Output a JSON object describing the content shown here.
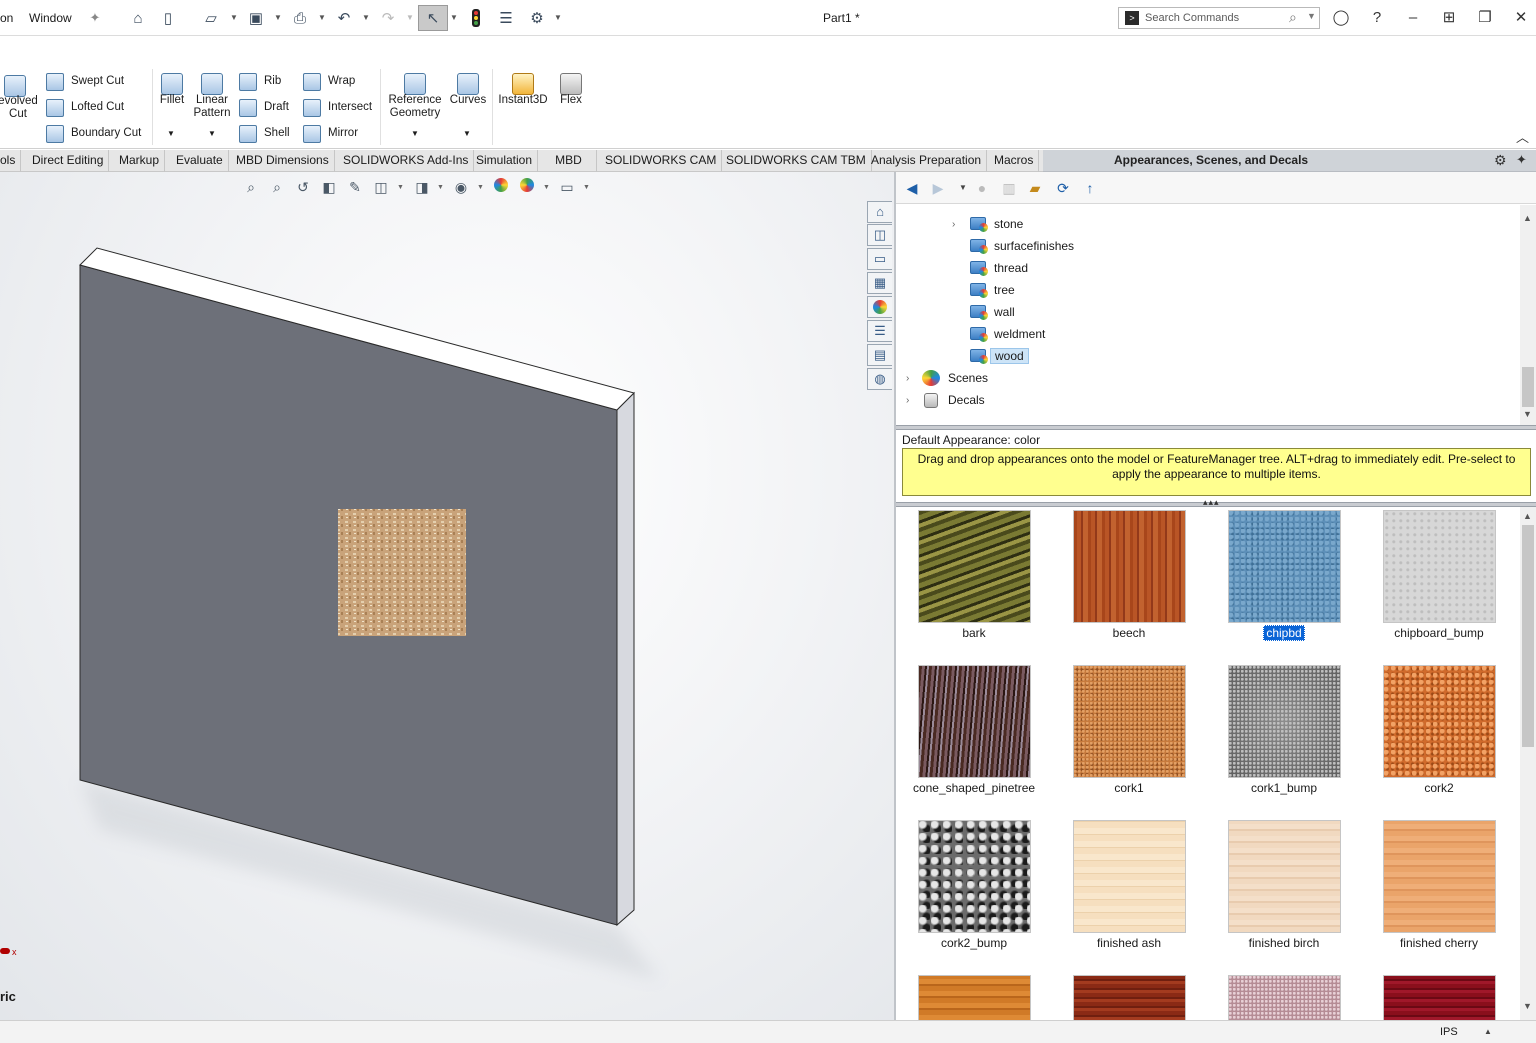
{
  "menu": {
    "item_partial": "on",
    "window": "Window"
  },
  "window_title": "Part1 *",
  "search": {
    "placeholder": "Search Commands"
  },
  "ribbon": {
    "revolved_cut": "evolved\nCut",
    "swept_cut": "Swept Cut",
    "lofted_cut": "Lofted Cut",
    "boundary_cut": "Boundary Cut",
    "fillet": "Fillet",
    "linear_pattern": "Linear\nPattern",
    "rib": "Rib",
    "draft": "Draft",
    "shell": "Shell",
    "wrap": "Wrap",
    "intersect": "Intersect",
    "mirror": "Mirror",
    "reference_geometry": "Reference\nGeometry",
    "curves": "Curves",
    "instant3d": "Instant3D",
    "flex": "Flex"
  },
  "tabs": [
    "ols",
    "Direct Editing",
    "Markup",
    "Evaluate",
    "MBD Dimensions",
    "SOLIDWORKS Add-Ins",
    "Simulation",
    "MBD",
    "SOLIDWORKS CAM",
    "SOLIDWORKS CAM TBM",
    "Analysis Preparation",
    "Macros"
  ],
  "task_pane": {
    "title": "Appearances, Scenes, and Decals",
    "tree": [
      {
        "label": "stone",
        "expandable": true
      },
      {
        "label": "surfacefinishes"
      },
      {
        "label": "thread"
      },
      {
        "label": "tree"
      },
      {
        "label": "wall"
      },
      {
        "label": "weldment"
      },
      {
        "label": "wood",
        "selected": true
      }
    ],
    "scenes": "Scenes",
    "decals": "Decals",
    "default_appearance": "Default Appearance: color",
    "hint": "Drag and drop appearances onto the model or FeatureManager tree.  ALT+drag to immediately edit.  Pre-select to apply the appearance to multiple items.",
    "gallery": [
      {
        "label": "bark",
        "texture": "bark"
      },
      {
        "label": "beech",
        "texture": "beech"
      },
      {
        "label": "chipbd",
        "texture": "chipbd",
        "selected": true
      },
      {
        "label": "chipboard_bump",
        "texture": "chipboard_bump"
      },
      {
        "label": "cone_shaped_pinetree",
        "texture": "pinetree"
      },
      {
        "label": "cork1",
        "texture": "cork1"
      },
      {
        "label": "cork1_bump",
        "texture": "cork1_bump"
      },
      {
        "label": "cork2",
        "texture": "cork2"
      },
      {
        "label": "cork2_bump",
        "texture": "cork2_bump"
      },
      {
        "label": "finished ash",
        "texture": "ash"
      },
      {
        "label": "finished birch",
        "texture": "birch"
      },
      {
        "label": "finished cherry",
        "texture": "cherry"
      }
    ]
  },
  "viewport": {
    "view_name_partial": "ric",
    "triad_axis": "x"
  },
  "status": {
    "units": "IPS"
  },
  "colors": {
    "accent": "#0a64d6",
    "hint_bg": "#ffff8f",
    "model_face": "#6d7079"
  }
}
